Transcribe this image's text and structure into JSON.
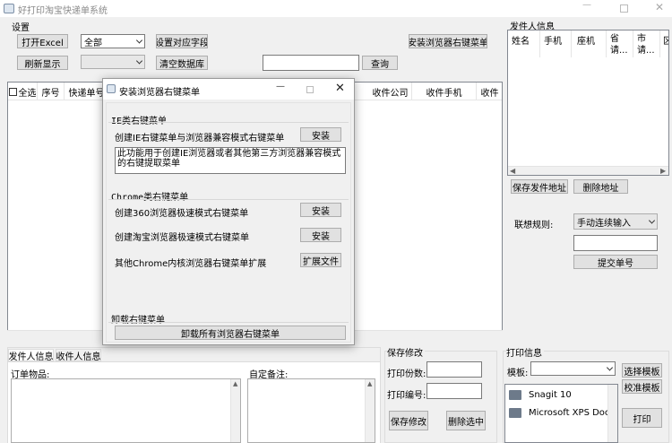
{
  "window": {
    "title": "好打印淘宝快递单系统"
  },
  "settings": {
    "group_label": "设置",
    "open_excel": "打开Excel",
    "filter_all": "全部",
    "set_fields": "设置对应字段",
    "install_browser_menu": "安装浏览器右键菜单",
    "refresh": "刷新显示",
    "clear_db": "清空数据库",
    "query": "查询",
    "search_value": ""
  },
  "main_table": {
    "columns": [
      "全选",
      "序号",
      "快递单号",
      "收件公司",
      "收件手机",
      "收件"
    ]
  },
  "sender": {
    "group_label": "发件人信息",
    "columns": [
      "姓名",
      "手机",
      "座机",
      "省请...",
      "市请...",
      "区"
    ],
    "save_address": "保存发件地址",
    "delete_address": "删除地址",
    "assoc_label": "联想规则:",
    "assoc_value": "手动连续输入",
    "submit_number": "提交单号"
  },
  "bottom": {
    "tab_sender": "发件人信息",
    "tab_receiver": "收件人信息",
    "order_items": "订单物品:",
    "custom_note": "自定备注:"
  },
  "save_changes": {
    "group_label": "保存修改",
    "print_count": "打印份数:",
    "print_number": "打印编号:",
    "save": "保存修改",
    "delete_selected": "删除选中"
  },
  "print_info": {
    "group_label": "打印信息",
    "template_label": "模板:",
    "select_template": "选择模板",
    "calibrate_template": "校准模板",
    "print": "打印",
    "printers": [
      "Snagit 10",
      "Microsoft XPS Docu"
    ]
  },
  "dialog": {
    "title": "安装浏览器右键菜单",
    "ie_section": "IE类右键菜单",
    "ie_item": "创建IE右键菜单与浏览器兼容模式右键菜单",
    "install": "安装",
    "ie_desc": "此功能用于创建IE浏览器或者其他第三方浏览器兼容模式的右键提取菜单",
    "chrome_section": "Chrome类右键菜单",
    "chrome_items": [
      "创建360浏览器极速模式右键菜单",
      "创建淘宝浏览器极速模式右键菜单",
      "其他Chrome内核浏览器右键菜单扩展"
    ],
    "ext_file": "扩展文件",
    "uninstall_section": "卸载右键菜单",
    "uninstall_all": "卸载所有浏览器右键菜单"
  }
}
